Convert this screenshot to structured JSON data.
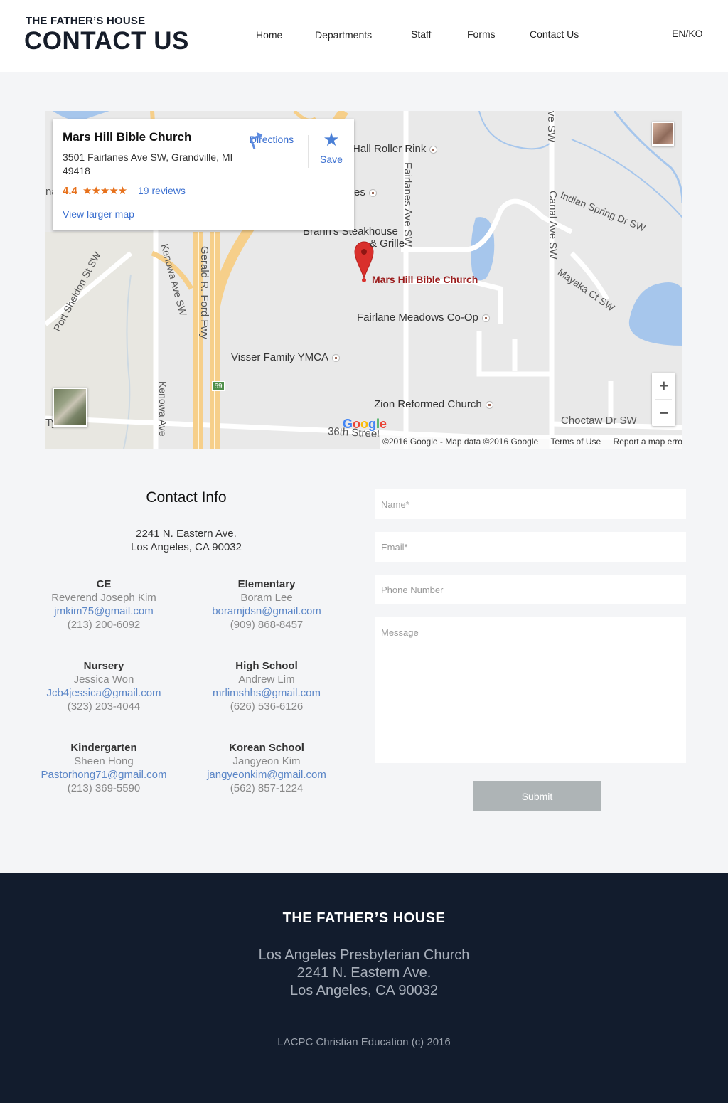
{
  "header": {
    "brand_small": "THE FATHER’S HOUSE",
    "brand_title": "CONTACT US",
    "nav": [
      "Home",
      "Departments",
      "Staff",
      "Forms",
      "Contact Us"
    ],
    "lang": "EN/KO"
  },
  "map": {
    "place_name": "Mars Hill Bible Church",
    "place_address": "3501 Fairlanes Ave SW, Grandville, MI 49418",
    "rating": "4.4",
    "stars": "★★★★★",
    "reviews": "19 reviews",
    "directions": "Directions",
    "save": "Save",
    "larger_map": "View larger map",
    "marker_label": "Mars Hill Bible Church",
    "labels": {
      "roller_rink": "Hall Roller Rink",
      "es": "es",
      "brann": "Brann's Steakhouse",
      "grille": "& Grille",
      "fairlane_meadows": "Fairlane Meadows Co-Op",
      "ymca": "Visser Family YMCA",
      "zion": "Zion Reformed Church",
      "choctaw": "Choctaw Dr SW",
      "street36": "36th Street",
      "indian_spring": "Indian Spring Dr SW",
      "mayaka": "Mayaka Ct SW",
      "fairlanes_ave": "Fairlanes Ave SW",
      "canal_ave": "Canal Ave SW",
      "ve_sw": "ve SW",
      "gerald_ford": "Gerald R. Ford Fwy",
      "kenowa1": "Kenowa Ave SW",
      "kenowa2": "Kenowa Ave",
      "port_sheldon": "Port Sheldon St SW",
      "hwy": "69",
      "na": "na",
      "ty": "Ty"
    },
    "zoom_in": "+",
    "zoom_out": "−",
    "google": "Google",
    "map_data": "©2016 Google - Map data ©2016 Google",
    "terms": "Terms of Use",
    "report": "Report a map error"
  },
  "contact": {
    "title": "Contact Info",
    "address_line1": "2241 N. Eastern Ave.",
    "address_line2": "Los Angeles, CA 90032",
    "departments": [
      {
        "name": "CE",
        "person": "Reverend Joseph Kim",
        "email": "jmkim75@gmail.com",
        "phone": "(213) 200-6092"
      },
      {
        "name": "Elementary",
        "person": "Boram Lee",
        "email": "boramjdsn@gmail.com",
        "phone": "(909) 868-8457"
      },
      {
        "name": "Nursery",
        "person": "Jessica Won",
        "email": "Jcb4jessica@gmail.com",
        "phone": "(323) 203-4044"
      },
      {
        "name": "High School",
        "person": "Andrew Lim",
        "email": "mrlimshhs@gmail.com",
        "phone": "(626) 536-6126"
      },
      {
        "name": "Kindergarten",
        "person": "Sheen Hong",
        "email": "Pastorhong71@gmail.com",
        "phone": "(213) 369-5590"
      },
      {
        "name": "Korean School",
        "person": "Jangyeon Kim",
        "email": "jangyeonkim@gmail.com",
        "phone": "(562) 857-1224"
      }
    ]
  },
  "form": {
    "name_placeholder": "Name*",
    "email_placeholder": "Email*",
    "phone_placeholder": "Phone Number",
    "message_placeholder": "Message",
    "submit": "Submit"
  },
  "footer": {
    "title": "THE FATHER’S HOUSE",
    "line1": "Los Angeles Presbyterian Church",
    "line2": "2241 N. Eastern Ave.",
    "line3": "Los Angeles, CA 90032",
    "copyright": "LACPC Christian Education (c) 2016"
  },
  "colors": {
    "footer_bg": "#121c2d",
    "page_bg": "#f4f5f7",
    "link": "#5b86c7",
    "submit_bg": "#aeb4b6",
    "marker": "#d9302c"
  }
}
